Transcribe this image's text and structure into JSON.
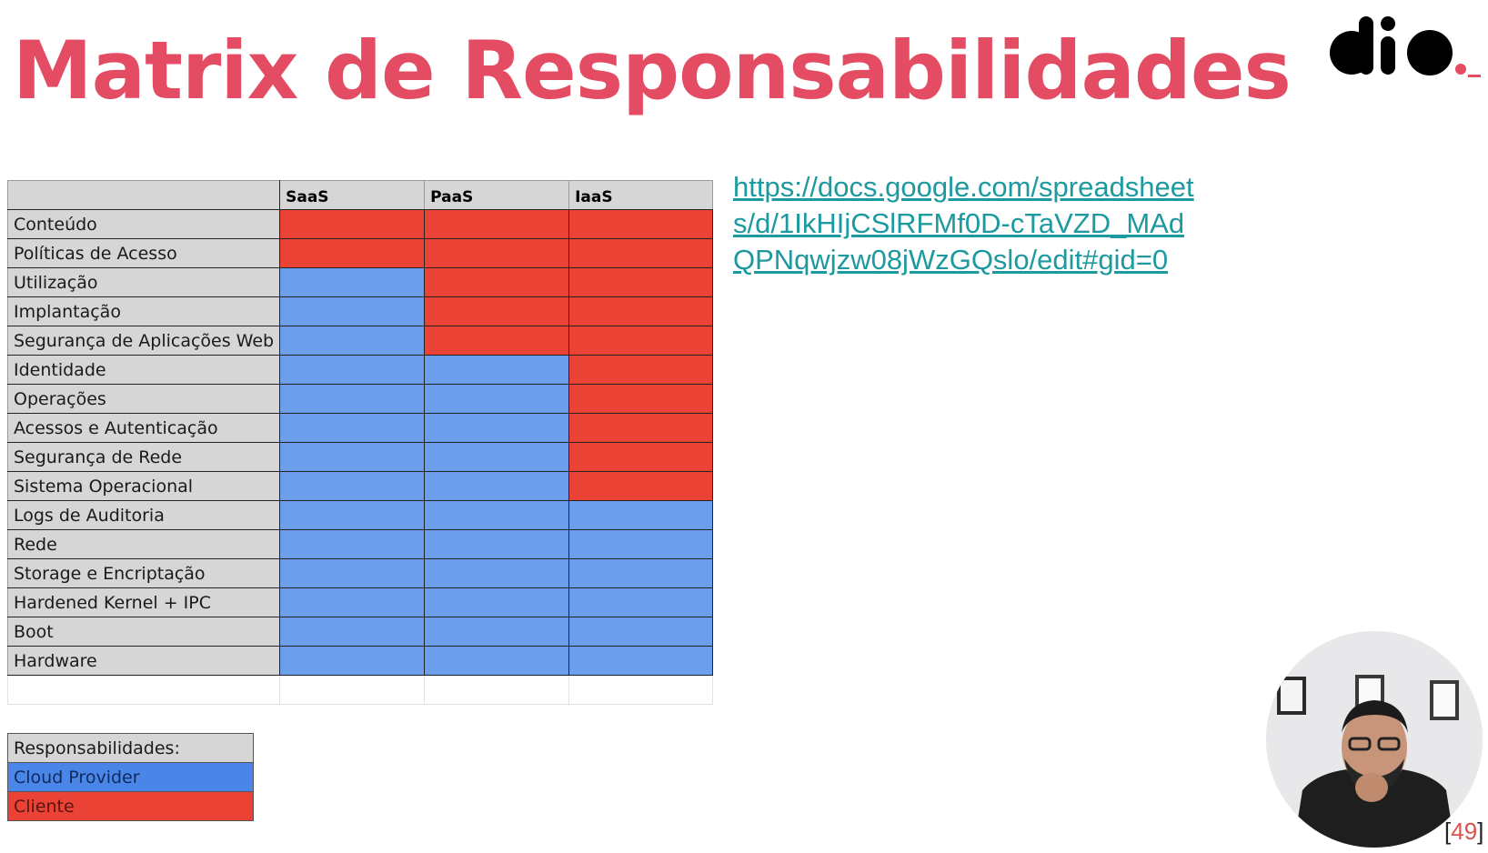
{
  "slide": {
    "title": "Matrix de Responsabilidades",
    "link_text": "https://docs.google.com/spreadsheets/d/1IkHIjCSlRFMf0D-cTaVZD_MAdQPNqwjzw08jWzGQslo/edit#gid=0",
    "page_number": "49"
  },
  "colors": {
    "title": "#e34c62",
    "cliente": "#ea4335",
    "cloud_provider": "#6d9eeb",
    "link": "#1c9aa0",
    "header_gray": "#d6d6d6"
  },
  "matrix": {
    "columns": [
      "SaaS",
      "PaaS",
      "IaaS"
    ],
    "rows": [
      {
        "label": "Conteúdo",
        "cells": [
          "Cliente",
          "Cliente",
          "Cliente"
        ]
      },
      {
        "label": "Políticas de Acesso",
        "cells": [
          "Cliente",
          "Cliente",
          "Cliente"
        ]
      },
      {
        "label": "Utilização",
        "cells": [
          "Cloud Provider",
          "Cliente",
          "Cliente"
        ]
      },
      {
        "label": "Implantação",
        "cells": [
          "Cloud Provider",
          "Cliente",
          "Cliente"
        ]
      },
      {
        "label": "Segurança de Aplicações Web",
        "cells": [
          "Cloud Provider",
          "Cliente",
          "Cliente"
        ]
      },
      {
        "label": "Identidade",
        "cells": [
          "Cloud Provider",
          "Cloud Provider",
          "Cliente"
        ]
      },
      {
        "label": "Operações",
        "cells": [
          "Cloud Provider",
          "Cloud Provider",
          "Cliente"
        ]
      },
      {
        "label": "Acessos e Autenticação",
        "cells": [
          "Cloud Provider",
          "Cloud Provider",
          "Cliente"
        ]
      },
      {
        "label": "Segurança de Rede",
        "cells": [
          "Cloud Provider",
          "Cloud Provider",
          "Cliente"
        ]
      },
      {
        "label": "Sistema Operacional",
        "cells": [
          "Cloud Provider",
          "Cloud Provider",
          "Cliente"
        ]
      },
      {
        "label": "Logs de Auditoria",
        "cells": [
          "Cloud Provider",
          "Cloud Provider",
          "Cloud Provider"
        ]
      },
      {
        "label": "Rede",
        "cells": [
          "Cloud Provider",
          "Cloud Provider",
          "Cloud Provider"
        ]
      },
      {
        "label": "Storage e Encriptação",
        "cells": [
          "Cloud Provider",
          "Cloud Provider",
          "Cloud Provider"
        ]
      },
      {
        "label": "Hardened Kernel + IPC",
        "cells": [
          "Cloud Provider",
          "Cloud Provider",
          "Cloud Provider"
        ]
      },
      {
        "label": "Boot",
        "cells": [
          "Cloud Provider",
          "Cloud Provider",
          "Cloud Provider"
        ]
      },
      {
        "label": "Hardware",
        "cells": [
          "Cloud Provider",
          "Cloud Provider",
          "Cloud Provider"
        ]
      }
    ]
  },
  "legend": {
    "heading": "Responsabilidades:",
    "cloud_provider": "Cloud Provider",
    "cliente": "Cliente"
  },
  "logo": {
    "icon": "dio-logo"
  },
  "webcam": {
    "icon": "presenter-webcam"
  }
}
